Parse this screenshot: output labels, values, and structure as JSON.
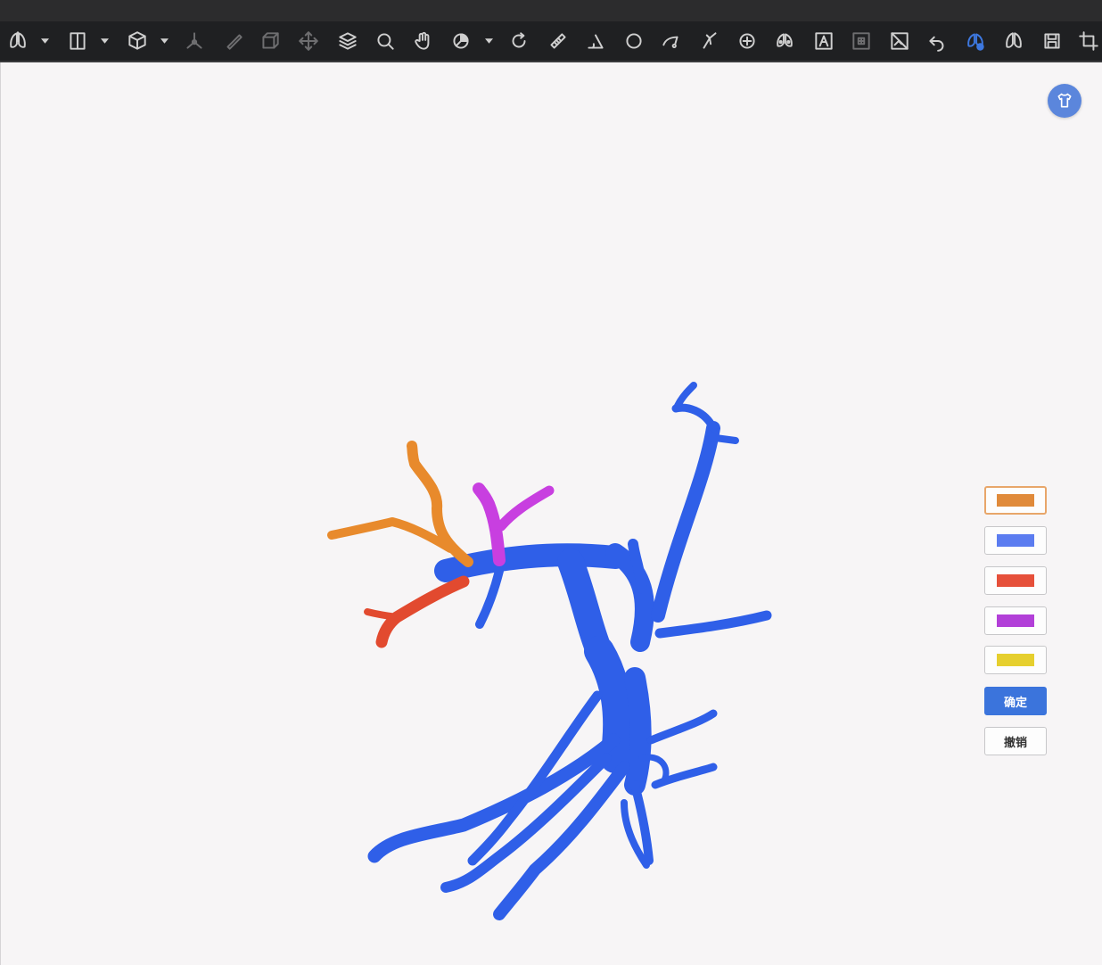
{
  "toolbar": {
    "tools": [
      {
        "icon": "lung-view-icon",
        "dropdown": true
      },
      {
        "icon": "layout-split-icon",
        "dropdown": true
      },
      {
        "icon": "cube-3d-icon",
        "dropdown": true
      },
      {
        "icon": "axes-icon",
        "dropdown": false
      },
      {
        "icon": "brush-icon",
        "dropdown": false
      },
      {
        "icon": "box-icon",
        "dropdown": false
      },
      {
        "icon": "move-icon",
        "dropdown": false
      },
      {
        "icon": "layers-icon",
        "dropdown": false
      },
      {
        "icon": "zoom-icon",
        "dropdown": false
      },
      {
        "icon": "pan-hand-icon",
        "dropdown": false
      },
      {
        "icon": "window-level-icon",
        "dropdown": true
      },
      {
        "icon": "rotate-icon",
        "dropdown": false
      },
      {
        "icon": "ruler-icon",
        "dropdown": false
      },
      {
        "icon": "angle-icon",
        "dropdown": false
      },
      {
        "icon": "ellipse-roi-icon",
        "dropdown": false
      },
      {
        "icon": "freehand-curve-icon",
        "dropdown": false
      },
      {
        "icon": "annotation-arrow-icon",
        "dropdown": false
      },
      {
        "icon": "crosshair-icon",
        "dropdown": false
      },
      {
        "icon": "lung-segment-icon",
        "dropdown": false
      },
      {
        "icon": "text-annotation-icon",
        "dropdown": false
      },
      {
        "icon": "grid-icon",
        "dropdown": false
      },
      {
        "icon": "invert-image-icon",
        "dropdown": false
      },
      {
        "icon": "undo-icon",
        "dropdown": false
      },
      {
        "icon": "vessel-color-icon",
        "dropdown": false,
        "active": true
      },
      {
        "icon": "lung-lobes-icon",
        "dropdown": false
      },
      {
        "icon": "save-icon",
        "dropdown": false
      },
      {
        "icon": "crop-icon",
        "dropdown": false
      }
    ]
  },
  "colors": {
    "toolbar_bg": "#1f2022",
    "icon_default": "#cfcfcf",
    "icon_disabled": "#6e6e70",
    "icon_active": "#3d78e0",
    "vessel_main": "#2f5fe8",
    "branch_orange": "#e88a2c",
    "branch_red": "#e24a2f",
    "branch_magenta": "#c83fe0"
  },
  "color_panel": {
    "swatches": [
      {
        "name": "orange",
        "color": "#e08a3a",
        "selected": true
      },
      {
        "name": "blue",
        "color": "#5b7cf0",
        "selected": false
      },
      {
        "name": "red",
        "color": "#e6503a",
        "selected": false
      },
      {
        "name": "purple",
        "color": "#b23fd8",
        "selected": false
      },
      {
        "name": "yellow",
        "color": "#e6cf2e",
        "selected": false
      }
    ],
    "confirm_label": "确定",
    "cancel_label": "撤销"
  },
  "skin_button_icon": "shirt-icon"
}
